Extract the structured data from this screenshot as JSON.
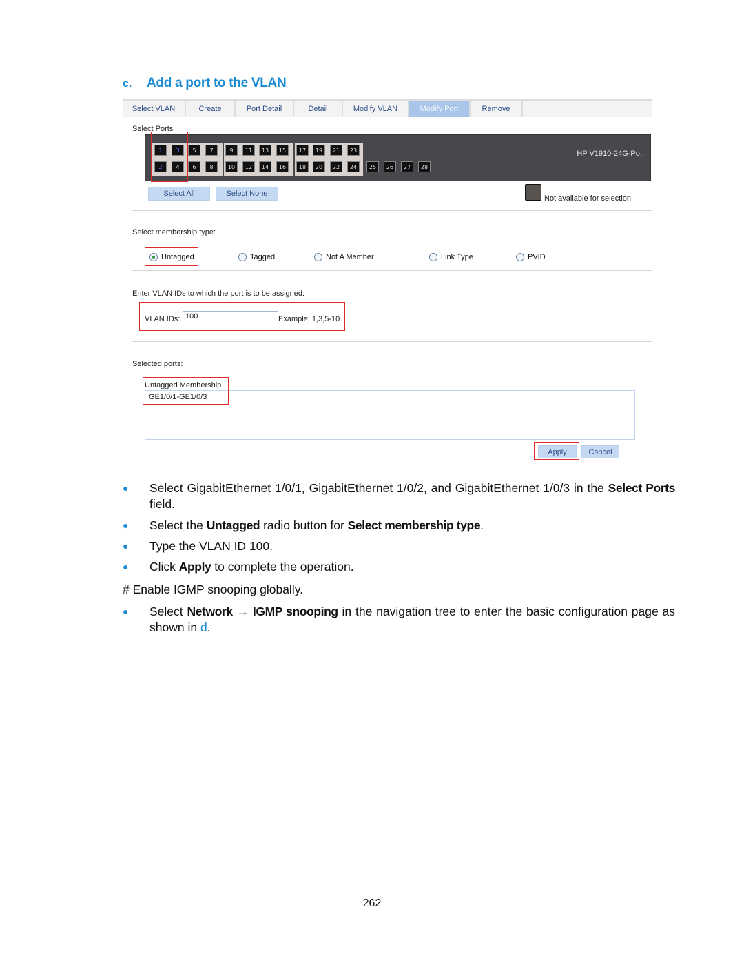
{
  "heading": {
    "label": "c.",
    "title": "Add a port to the VLAN"
  },
  "colors": {
    "heading": "#1b8bd3",
    "active_tab": "#a9c6ea",
    "highlight": "#e02a2a",
    "switch_panel": "#48474c"
  },
  "ui": {
    "tabs": [
      {
        "label": "Select VLAN"
      },
      {
        "label": "Create"
      },
      {
        "label": "Port Detail"
      },
      {
        "label": "Detail"
      },
      {
        "label": "Modify VLAN"
      },
      {
        "label": "Modify Port",
        "active": true
      },
      {
        "label": "Remove"
      }
    ],
    "select_ports_label": "Select Ports",
    "device_name": "HP V1910-24G-Po...",
    "ports": {
      "selected": [
        1,
        2,
        3
      ],
      "top_row": [
        1,
        3,
        5,
        7,
        9,
        11,
        13,
        15,
        17,
        19,
        21,
        23
      ],
      "bottom_row": [
        2,
        4,
        6,
        8,
        10,
        12,
        14,
        16,
        18,
        20,
        22,
        24
      ],
      "extra": [
        25,
        26,
        27,
        28
      ]
    },
    "select_all": "Select All",
    "select_none": "Select None",
    "legend_unavailable": "Not avaliable for selection",
    "membership_label": "Select membership type:",
    "membership_options": [
      {
        "label": "Untagged",
        "checked": true
      },
      {
        "label": "Tagged"
      },
      {
        "label": "Not A Member"
      },
      {
        "label": "Link Type"
      },
      {
        "label": "PVID"
      }
    ],
    "vlan_prompt": "Enter VLAN IDs to which the port is to be assigned:",
    "vlan_ids_label": "VLAN IDs:",
    "vlan_ids_value": "100",
    "vlan_example": "Example: 1,3,5-10",
    "selected_ports_label": "Selected ports:",
    "membership_header": "Untagged Membership",
    "membership_ports": "GE1/0/1-GE1/0/3",
    "apply": "Apply",
    "cancel": "Cancel"
  },
  "steps": [
    {
      "parts": [
        "Select GigabitEthernet 1/0/1, GigabitEthernet 1/0/2, and GigabitEthernet 1/0/3 in the ",
        "Select Ports",
        " field."
      ]
    },
    {
      "parts": [
        "Select the ",
        "Untagged",
        " radio button for ",
        "Select membership type",
        "."
      ]
    },
    {
      "parts": [
        "Type the VLAN ID 100."
      ]
    },
    {
      "parts": [
        "Click ",
        "Apply",
        " to complete the operation."
      ]
    }
  ],
  "comment": "# Enable IGMP snooping globally.",
  "step2": {
    "parts": [
      "Select ",
      "Network",
      " → ",
      "IGMP snooping",
      " in the navigation tree to enter the basic configuration page as shown in ",
      "d",
      "."
    ]
  },
  "page_number": "262"
}
